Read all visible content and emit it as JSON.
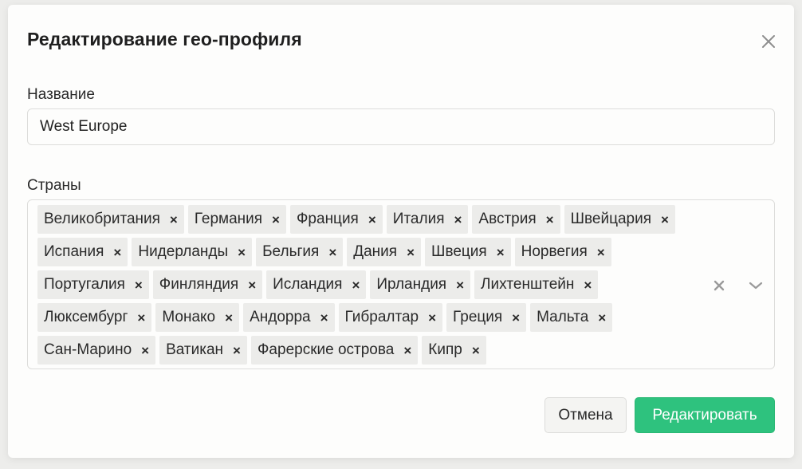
{
  "modal": {
    "title": "Редактирование гео-профиля"
  },
  "form": {
    "name_label": "Название",
    "name_value": "West Europe",
    "countries_label": "Страны",
    "countries": [
      "Великобритания",
      "Германия",
      "Франция",
      "Италия",
      "Австрия",
      "Швейцария",
      "Испания",
      "Нидерланды",
      "Бельгия",
      "Дания",
      "Швеция",
      "Норвегия",
      "Португалия",
      "Финляндия",
      "Исландия",
      "Ирландия",
      "Лихтенштейн",
      "Люксембург",
      "Монако",
      "Андорра",
      "Гибралтар",
      "Греция",
      "Мальта",
      "Сан-Марино",
      "Ватикан",
      "Фарерские острова",
      "Кипр"
    ],
    "chip_remove_glyph": "×"
  },
  "footer": {
    "cancel_label": "Отмена",
    "submit_label": "Редактировать"
  },
  "colors": {
    "accent": "#2ec27e",
    "chip_bg": "#ececea",
    "icon_gray": "#9a9a9a"
  },
  "icons": {
    "close": "close-icon",
    "clear": "clear-icon",
    "dropdown": "chevron-down-icon"
  }
}
